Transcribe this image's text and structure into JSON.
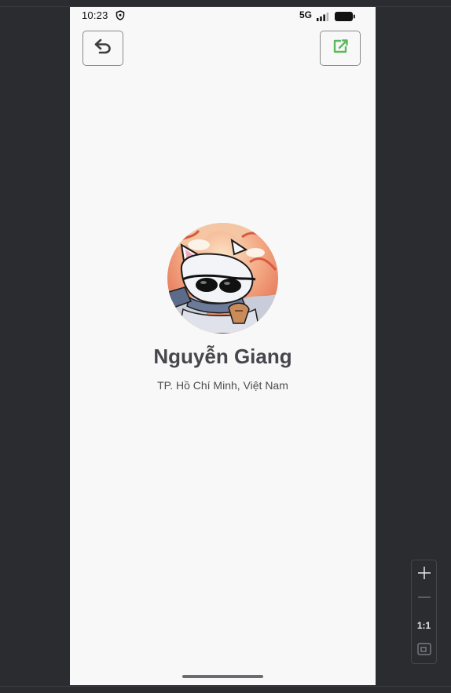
{
  "status_bar": {
    "time": "10:23",
    "network": "5G",
    "icons": [
      "shield-icon",
      "signal-icon",
      "battery-icon"
    ]
  },
  "header": {
    "back_icon": "undo-arrow-icon",
    "share_icon": "share-external-icon",
    "accent_color": "#4caf50"
  },
  "profile": {
    "name": "Nguyễn Giang",
    "location": "TP. Hồ Chí Minh, Việt Nam"
  },
  "viewer_controls": {
    "zoom_in_icon": "plus-icon",
    "zoom_out_icon": "minus-icon",
    "actual_size_label": "1:1",
    "fit_icon": "fit-screen-icon"
  }
}
